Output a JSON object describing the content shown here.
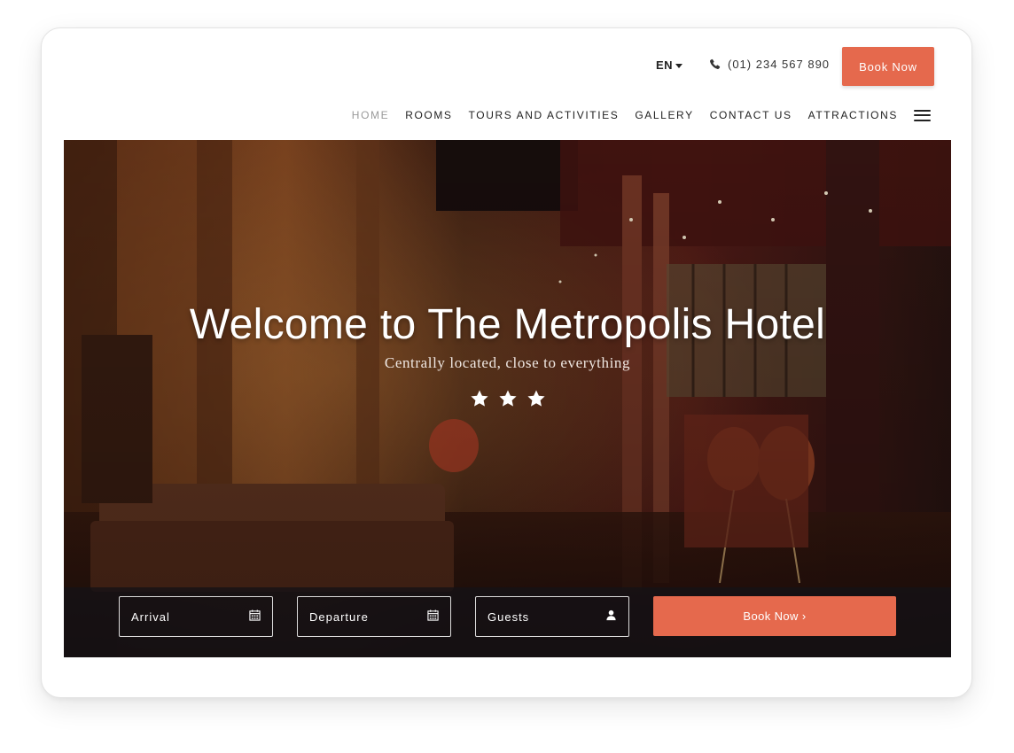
{
  "header": {
    "language": "EN",
    "phone": "(01) 234 567 890",
    "book_now_label": "Book Now"
  },
  "nav": {
    "items": [
      {
        "label": "HOME",
        "active": true
      },
      {
        "label": "ROOMS",
        "active": false
      },
      {
        "label": "TOURS AND ACTIVITIES",
        "active": false
      },
      {
        "label": "GALLERY",
        "active": false
      },
      {
        "label": "CONTACT US",
        "active": false
      },
      {
        "label": "ATTRACTIONS",
        "active": false
      }
    ]
  },
  "hero": {
    "title": "Welcome to The Metropolis Hotel",
    "subtitle": "Centrally located, close to everything",
    "star_rating": 3
  },
  "booking": {
    "arrival_label": "Arrival",
    "departure_label": "Departure",
    "guests_label": "Guests",
    "submit_label": "Book Now  ›"
  },
  "icons": {
    "phone": "phone-icon",
    "calendar": "calendar-icon",
    "user": "user-icon",
    "menu": "hamburger-menu-icon",
    "star": "star-icon"
  },
  "colors": {
    "accent": "#e5694d",
    "nav_active": "#9a9a9a",
    "text_dark": "#222222"
  }
}
